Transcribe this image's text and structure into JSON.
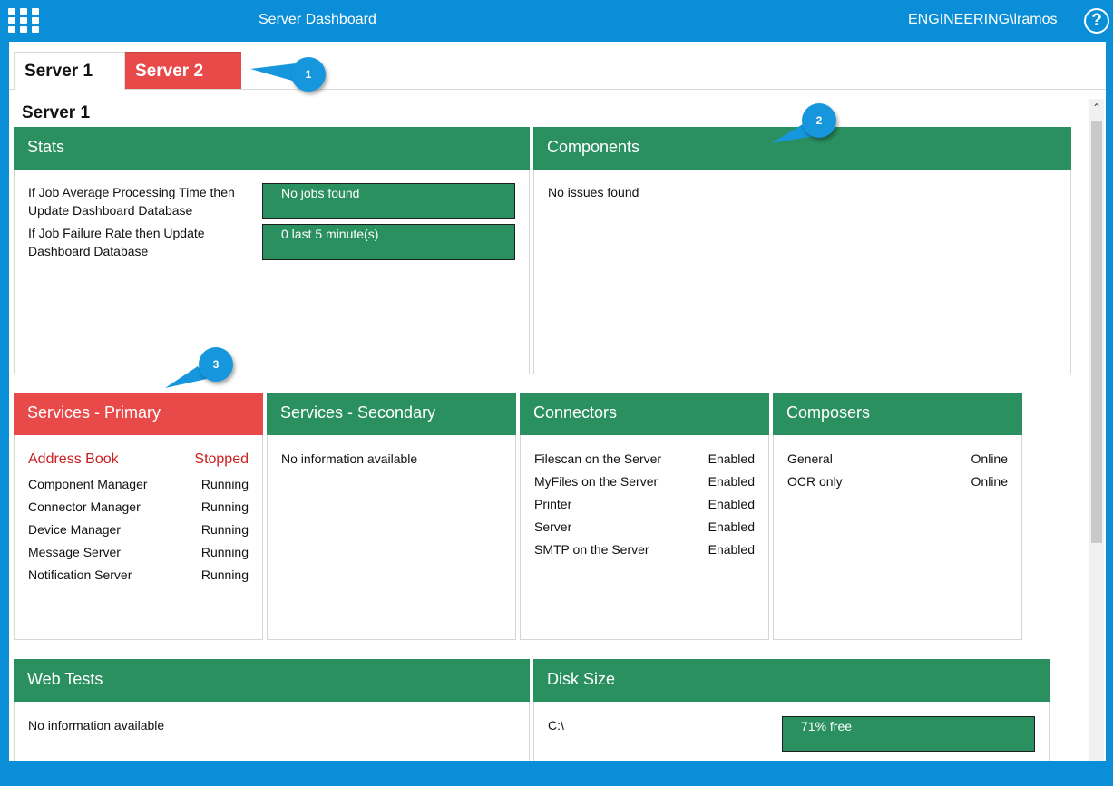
{
  "header": {
    "title": "Server Dashboard",
    "user": "ENGINEERING\\lramos",
    "help_glyph": "?"
  },
  "tabs": [
    {
      "label": "Server 1",
      "active": true
    },
    {
      "label": "Server 2",
      "status_color": "#e84a4a"
    }
  ],
  "page": {
    "title": "Server 1"
  },
  "stats": {
    "title": "Stats",
    "rows": [
      {
        "label": "If Job Average Processing Time then Update Dashboard Database",
        "value": "No jobs found"
      },
      {
        "label": "If Job Failure Rate then Update Dashboard Database",
        "value": "0 last 5 minute(s)"
      }
    ]
  },
  "components": {
    "title": "Components",
    "message": "No issues found"
  },
  "services_primary": {
    "title": "Services - Primary",
    "rows": [
      {
        "name": "Address Book",
        "status": "Stopped"
      },
      {
        "name": "Component Manager",
        "status": "Running"
      },
      {
        "name": "Connector Manager",
        "status": "Running"
      },
      {
        "name": "Device Manager",
        "status": "Running"
      },
      {
        "name": "Message Server",
        "status": "Running"
      },
      {
        "name": "Notification Server",
        "status": "Running"
      }
    ]
  },
  "services_secondary": {
    "title": "Services - Secondary",
    "message": "No information available"
  },
  "connectors": {
    "title": "Connectors",
    "rows": [
      {
        "name": "Filescan on the Server",
        "status": "Enabled"
      },
      {
        "name": "MyFiles on the Server",
        "status": "Enabled"
      },
      {
        "name": "Printer",
        "status": "Enabled"
      },
      {
        "name": "Server",
        "status": "Enabled"
      },
      {
        "name": "SMTP on the Server",
        "status": "Enabled"
      }
    ]
  },
  "composers": {
    "title": "Composers",
    "rows": [
      {
        "name": "General",
        "status": "Online"
      },
      {
        "name": "OCR only",
        "status": "Online"
      }
    ]
  },
  "web_tests": {
    "title": "Web Tests",
    "message": "No information available"
  },
  "disk_size": {
    "title": "Disk Size",
    "drive": "C:\\",
    "free_label": "71% free",
    "free_percent": 71
  },
  "callouts": [
    "1",
    "2",
    "3"
  ],
  "colors": {
    "header_blue": "#0a8ed8",
    "ok_green": "#2a9060",
    "alert_red": "#e84a4a",
    "stopped_text": "#c92020",
    "callout_blue": "#1696dd"
  }
}
